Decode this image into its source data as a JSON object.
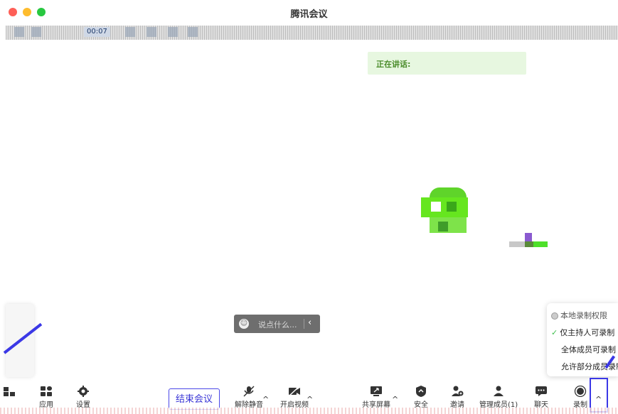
{
  "window": {
    "title": "腾讯会议"
  },
  "statusbar": {
    "timer": "00:07"
  },
  "speaking": {
    "label": "正在讲话:"
  },
  "chat": {
    "placeholder": "说点什么..."
  },
  "record_menu": {
    "header": "本地录制权限",
    "options": [
      {
        "label": "仅主持人可录制",
        "selected": true
      },
      {
        "label": "全体成员可录制",
        "selected": false
      },
      {
        "label": "允许部分成员录制",
        "selected": false
      }
    ]
  },
  "toolbar": {
    "left_items": [
      {
        "label": "应用",
        "icon": "apps-icon"
      },
      {
        "label": "设置",
        "icon": "gear-icon"
      }
    ],
    "end_meeting": "结束会议",
    "center_items": [
      {
        "label": "解除静音",
        "icon": "mic-muted-icon"
      },
      {
        "label": "开启视频",
        "icon": "video-off-icon"
      }
    ],
    "right_items": [
      {
        "label": "共享屏幕",
        "icon": "share-screen-icon"
      },
      {
        "label": "安全",
        "icon": "shield-icon"
      },
      {
        "label": "邀请",
        "icon": "invite-icon"
      },
      {
        "label": "管理成员(1)",
        "icon": "members-icon"
      },
      {
        "label": "聊天",
        "icon": "chat-icon"
      },
      {
        "label": "录制",
        "icon": "record-icon"
      }
    ]
  },
  "colors": {
    "accent": "#3b38e6",
    "speaking_bg": "#e7f7e0",
    "speaking_text": "#4a8c2a",
    "check": "#3fbf4d"
  }
}
